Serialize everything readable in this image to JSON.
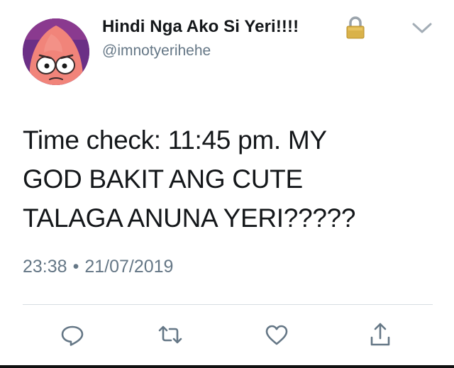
{
  "author": {
    "display_name": "Hindi Nga Ako Si Yeri!!!!",
    "handle": "@imnotyerihehe",
    "protected_icon": "lock-icon",
    "avatar_icon": "cartoon-face-avatar"
  },
  "tweet": {
    "lines": [
      "Time check: 11:45 pm. MY",
      "GOD BAKIT ANG CUTE",
      "TALAGA ANUNA YERI?????"
    ],
    "time": "23:38",
    "separator": "•",
    "date": "21/07/2019"
  },
  "menu": {
    "icon": "chevron-down-icon"
  },
  "actions": [
    {
      "icon": "reply-icon"
    },
    {
      "icon": "retweet-icon"
    },
    {
      "icon": "like-icon"
    },
    {
      "icon": "share-icon"
    }
  ],
  "colors": {
    "text_primary": "#14171a",
    "text_secondary": "#657786",
    "divider": "#d7dde2",
    "icon": "#657786",
    "lock_gold": "#c9a23a",
    "avatar_background": "#6b2f86"
  }
}
